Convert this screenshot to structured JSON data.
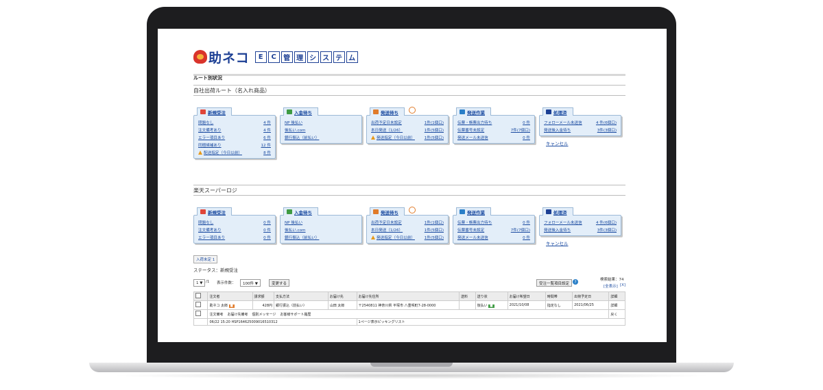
{
  "logo": {
    "text": "助ネコ",
    "boxes": [
      "E",
      "C",
      "管",
      "理",
      "シ",
      "ス",
      "テ",
      "ム"
    ]
  },
  "section_title": "ルート別状況",
  "routes": [
    {
      "name": "自社出荷ルート（名入れ商品）",
      "panels": [
        {
          "title": "新規受注",
          "icon_color": "#e0463a",
          "rows": [
            {
              "label": "問題なし",
              "value": "4 件"
            },
            {
              "label": "注文備考あり",
              "value": "4 件"
            },
            {
              "label": "エラー項目あり",
              "value": "6 件"
            },
            {
              "label": "同梱候補あり",
              "value": "12 件"
            },
            {
              "label": "配送指定（今日以前）",
              "value": "8 件",
              "warn": true
            }
          ]
        },
        {
          "title": "入金待ち",
          "icon_color": "#3f9b43",
          "rows": [
            {
              "label": "NP 後払い",
              "value": ""
            },
            {
              "label": "後払い.com",
              "value": ""
            },
            {
              "label": "銀行振込（前払い）",
              "value": ""
            }
          ]
        },
        {
          "title": "発送待ち",
          "icon_color": "#e07b2a",
          "rows": [
            {
              "label": "出荷予定日未設定",
              "value": "1件(1個口)"
            },
            {
              "label": "本日発送（1/26）",
              "value": "1件(5個口)"
            },
            {
              "label": "発送指定（今日以前）",
              "value": "1件(5個口)",
              "warn": true
            }
          ]
        },
        {
          "title": "発送作業",
          "icon_color": "#2a7fc8",
          "rows": [
            {
              "label": "伝票・帳票出力待ち",
              "value": "0 件"
            },
            {
              "label": "伝票番号未設定",
              "value": "7件(7個口)"
            },
            {
              "label": "発送メール未送信",
              "value": "0 件"
            }
          ]
        },
        {
          "title": "処理済",
          "icon_color": "#1c3f94",
          "rows": [
            {
              "label": "フォローメール未送信",
              "value": "4 件(6個口)"
            },
            {
              "label": "発送後入金待ち",
              "value": "3件(3個口)"
            }
          ],
          "cancel": "キャンセル"
        }
      ]
    },
    {
      "name": "楽天スーパーロジ",
      "panels": [
        {
          "title": "新規受注",
          "icon_color": "#e0463a",
          "rows": [
            {
              "label": "問題なし",
              "value": "0 件"
            },
            {
              "label": "注文備考あり",
              "value": "0 件"
            },
            {
              "label": "エラー項目あり",
              "value": "0 件"
            }
          ]
        },
        {
          "title": "入金待ち",
          "icon_color": "#3f9b43",
          "rows": [
            {
              "label": "NP 後払い",
              "value": ""
            },
            {
              "label": "後払い.com",
              "value": ""
            },
            {
              "label": "銀行振込（前払い）",
              "value": ""
            }
          ]
        },
        {
          "title": "発送待ち",
          "icon_color": "#e07b2a",
          "rows": [
            {
              "label": "出荷予定日未設定",
              "value": "1件(1個口)"
            },
            {
              "label": "本日発送（1/26）",
              "value": "1件(5個口)"
            },
            {
              "label": "発送指定（今日以前）",
              "value": "1件(5個口)",
              "warn": true
            }
          ]
        },
        {
          "title": "発送作業",
          "icon_color": "#2a7fc8",
          "rows": [
            {
              "label": "伝票・帳票出力待ち",
              "value": "0 件"
            },
            {
              "label": "伝票番号未設定",
              "value": "7件(7個口)"
            },
            {
              "label": "発送メール未送信",
              "value": "0 件"
            }
          ]
        },
        {
          "title": "処理済",
          "icon_color": "#1c3f94",
          "rows": [
            {
              "label": "フォローメール未送信",
              "value": "4 件(6個口)"
            },
            {
              "label": "発送後入金待ち",
              "value": "3件(3個口)"
            }
          ],
          "cancel": "キャンセル"
        }
      ]
    }
  ],
  "status": {
    "small_button": "入荷未定 1",
    "label": "ステータス：新規受注",
    "page_select": "1 ▼",
    "page_total": "/1",
    "per_page_label": "表示件数：",
    "per_page_value": "100件 ▼",
    "change_button": "変更する",
    "list_button": "受注一覧項目設定",
    "count_label": "検索結果：74",
    "all_display": "[全表示]",
    "close_x": "[X]"
  },
  "table": {
    "headers": [
      "",
      "注文者",
      "請求額",
      "支払方法",
      "お届け先",
      "お届け先住所",
      "送料",
      "送り状",
      "お届け希望日",
      "時間帯",
      "出荷予定日",
      "詳細"
    ],
    "row": {
      "customer": "助ネコ 太郎",
      "amount": "428円",
      "payment": "銀行振込（前払い）",
      "recipient": "山田 太郎",
      "address": "〒2540811 神奈川県 平塚市 八重咲町7-28-0000",
      "slip": "後払い",
      "delivery_date": "2021/10/08",
      "time_slot": "指定なし",
      "ship_date": "2021/06/25",
      "detail": "詳細",
      "links": [
        "注文備考",
        "お届け先備考",
        "個別メッセージ",
        "お客様サポート履歴"
      ],
      "return_btn": "戻く",
      "footer": "06/22 15:20  HSP164625009016510312",
      "picking": "1ページ表示ピッキングリスト"
    }
  }
}
